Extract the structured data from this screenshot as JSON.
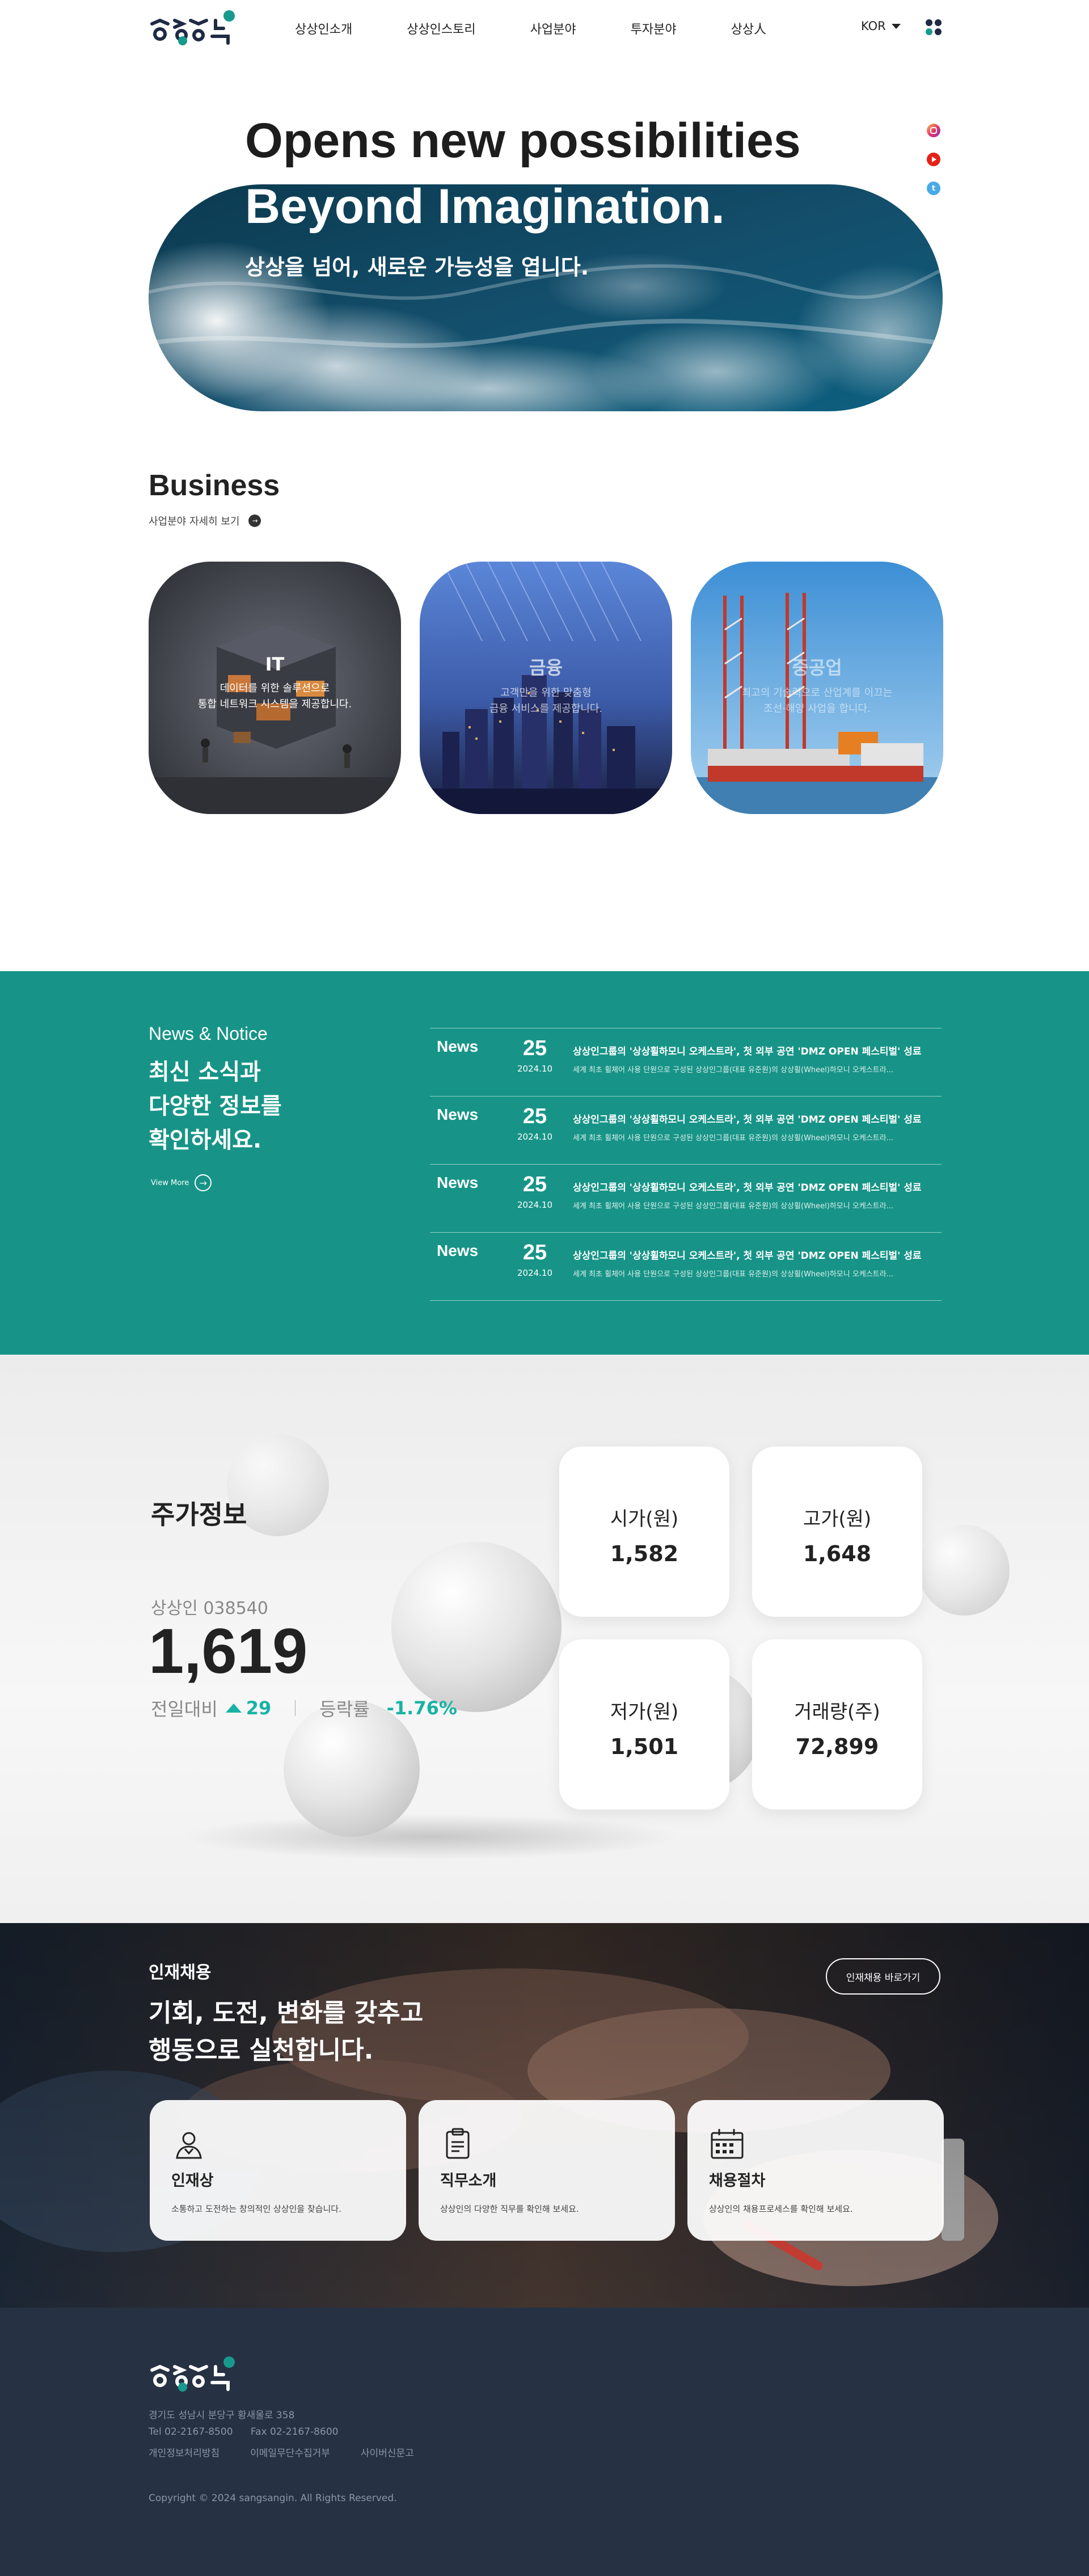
{
  "header": {
    "brand": "상상인",
    "nav": [
      "상상인소개",
      "상상인스토리",
      "사업분야",
      "투자분야",
      "상상人"
    ],
    "language": "KOR"
  },
  "hero": {
    "title_line1": "Opens new possibilities",
    "title_line2": "Beyond Imagination.",
    "subtitle": "상상을 넘어, 새로운 가능성을 엽니다.",
    "sns": [
      "instagram-icon",
      "youtube-icon",
      "twitter-icon"
    ]
  },
  "business": {
    "title": "Business",
    "more_label": "사업분야 자세히 보기",
    "cards": [
      {
        "name": "IT",
        "desc_line1": "데이터를 위한 솔루션으로",
        "desc_line2": "통합 네트워크 시스템을 제공합니다."
      },
      {
        "name": "금융",
        "desc_line1": "고객만을 위한 맞춤형",
        "desc_line2": "금융 서비스를 제공합니다."
      },
      {
        "name": "중공업",
        "desc_line1": "최고의 기술력으로 산업계를 이끄는",
        "desc_line2": "조선·해양 사업을 합니다."
      }
    ]
  },
  "news": {
    "label": "News & Notice",
    "headline_line1": "최신 소식과",
    "headline_line2": "다양한 정보를",
    "headline_line3": "확인하세요.",
    "view_more": "View More",
    "items": [
      {
        "category": "News",
        "day": "25",
        "year_month": "2024.10",
        "title": "상상인그룹의 '상상휠하모니 오케스트라', 첫 외부 공연 'DMZ OPEN 페스티벌' 성료",
        "desc": "세계 최초 휠체어 사용 단원으로 구성된 상상인그룹(대표 유준원)의 상상휠(Wheel)하모니 오케스트라..."
      },
      {
        "category": "News",
        "day": "25",
        "year_month": "2024.10",
        "title": "상상인그룹의 '상상휠하모니 오케스트라', 첫 외부 공연 'DMZ OPEN 페스티벌' 성료",
        "desc": "세계 최초 휠체어 사용 단원으로 구성된 상상인그룹(대표 유준원)의 상상휠(Wheel)하모니 오케스트라..."
      },
      {
        "category": "News",
        "day": "25",
        "year_month": "2024.10",
        "title": "상상인그룹의 '상상휠하모니 오케스트라', 첫 외부 공연 'DMZ OPEN 페스티벌' 성료",
        "desc": "세계 최초 휠체어 사용 단원으로 구성된 상상인그룹(대표 유준원)의 상상휠(Wheel)하모니 오케스트라..."
      },
      {
        "category": "News",
        "day": "25",
        "year_month": "2024.10",
        "title": "상상인그룹의 '상상휠하모니 오케스트라', 첫 외부 공연 'DMZ OPEN 페스티벌' 성료",
        "desc": "세계 최초 휠체어 사용 단원으로 구성된 상상인그룹(대표 유준원)의 상상휠(Wheel)하모니 오케스트라..."
      }
    ]
  },
  "stock": {
    "title": "주가정보",
    "code": "상상인 038540",
    "price": "1,619",
    "change_label": "전일대비",
    "change_value": "29",
    "rate_label": "등락률",
    "rate_value": "-1.76%",
    "accent_color": "#17b3a5",
    "cards": [
      {
        "label": "시가(원)",
        "value": "1,582"
      },
      {
        "label": "고가(원)",
        "value": "1,648"
      },
      {
        "label": "저가(원)",
        "value": "1,501"
      },
      {
        "label": "거래량(주)",
        "value": "72,899"
      }
    ]
  },
  "careers": {
    "label": "인재채용",
    "headline_line1": "기회, 도전, 변화를 갖추고",
    "headline_line2": "행동으로 실천합니다.",
    "button": "인재채용 바로가기",
    "cards": [
      {
        "icon": "person-icon",
        "name": "인재상",
        "desc": "소통하고 도전하는 창의적인 상상인을 찾습니다."
      },
      {
        "icon": "clipboard-icon",
        "name": "직무소개",
        "desc": "상상인의 다양한 직무를 확인해 보세요."
      },
      {
        "icon": "calendar-icon",
        "name": "채용절차",
        "desc": "상상인의 채용프로세스를 확인해 보세요."
      }
    ]
  },
  "footer": {
    "address": "경기도 성남시 분당구 황새울로 358",
    "tel": "Tel 02-2167-8500",
    "fax": "Fax 02-2167-8600",
    "links": [
      "개인정보처리방침",
      "이메일무단수집거부",
      "사이버신문고"
    ],
    "copyright": "Copyright © 2024 sangsangin. All Rights Reserved."
  },
  "colors": {
    "brand_teal": "#179487",
    "footer_bg": "#263143",
    "dark_navy": "#1f2a44"
  }
}
